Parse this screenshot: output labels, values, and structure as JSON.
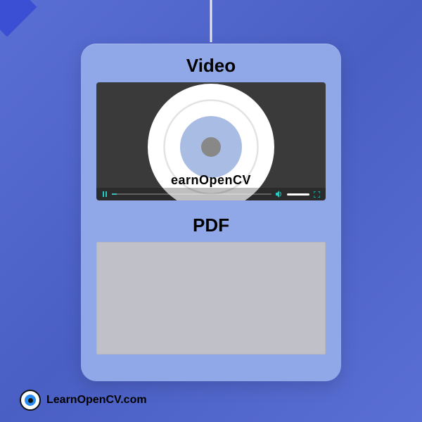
{
  "connector": {
    "present": true
  },
  "card": {
    "video": {
      "title": "Video",
      "overlay_text": "earnOpenCV",
      "controls": {
        "play_state": "playing",
        "progress_pct": 3,
        "volume_pct": 80
      }
    },
    "pdf": {
      "title": "PDF"
    }
  },
  "footer": {
    "brand": "LearnOpenCV.com"
  },
  "palette": {
    "bg_start": "#5a6fd4",
    "card": "#90a8e8",
    "accent": "#2ac8c0"
  }
}
